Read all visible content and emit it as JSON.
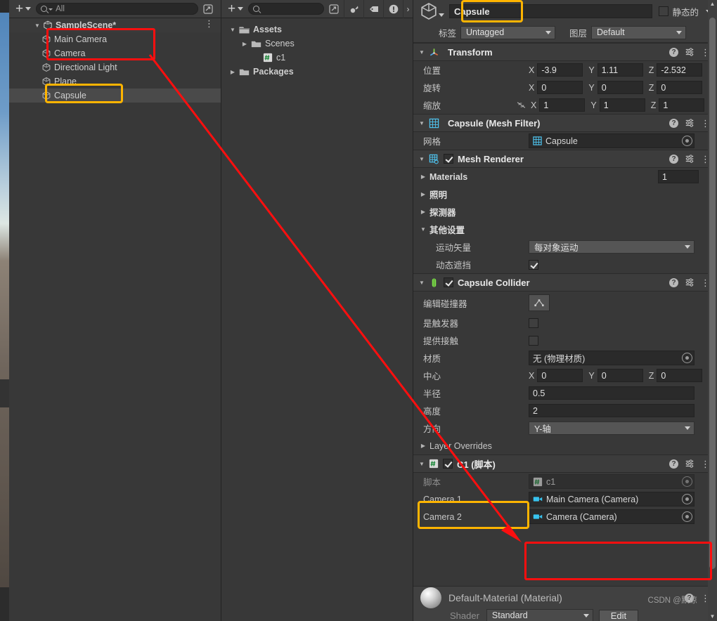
{
  "app": {
    "watermark": "CSDN @默凉"
  },
  "hierarchy": {
    "toolbar": {
      "add_label": "+",
      "search_placeholder": "All",
      "search_value": "",
      "expand_icon": "expand-icon"
    },
    "scene_name": "SampleScene*",
    "items": [
      {
        "label": "Main Camera",
        "icon": "gameobject-icon",
        "selected": false,
        "indent": 1
      },
      {
        "label": "Camera",
        "icon": "gameobject-icon",
        "selected": false,
        "indent": 1
      },
      {
        "label": "Directional Light",
        "icon": "gameobject-icon",
        "selected": false,
        "indent": 1
      },
      {
        "label": "Plane",
        "icon": "gameobject-icon",
        "selected": false,
        "indent": 1
      },
      {
        "label": "Capsule",
        "icon": "gameobject-icon",
        "selected": true,
        "indent": 1
      }
    ]
  },
  "project": {
    "toolbar": {
      "add_label": "+",
      "search_placeholder": "",
      "icons": [
        "save-search-icon",
        "label-icon",
        "warning-icon"
      ]
    },
    "items": [
      {
        "label": "Assets",
        "icon": "folder-open-icon",
        "expanded": true,
        "indent": 0,
        "bold": true
      },
      {
        "label": "Scenes",
        "icon": "folder-icon",
        "expanded": false,
        "indent": 1,
        "bold": false
      },
      {
        "label": "c1",
        "icon": "cs-script-icon",
        "expanded": null,
        "indent": 2,
        "bold": false
      },
      {
        "label": "Packages",
        "icon": "folder-icon",
        "expanded": false,
        "indent": 0,
        "bold": true
      }
    ]
  },
  "inspector": {
    "object": {
      "name": "Capsule",
      "static_label": "静态的",
      "static_checked": false,
      "tag_label": "标签",
      "tag_value": "Untagged",
      "layer_label": "图层",
      "layer_value": "Default"
    },
    "components": [
      {
        "id": "transform",
        "title": "Transform",
        "icon": "transform-axis-icon",
        "has_checkbox": false,
        "rows": [
          {
            "label": "位置",
            "type": "vector3",
            "x": "-3.9",
            "y": "1.11",
            "z": "-2.532"
          },
          {
            "label": "旋转",
            "type": "vector3",
            "x": "0",
            "y": "0",
            "z": "0"
          },
          {
            "label": "缩放",
            "type": "vector3",
            "x": "1",
            "y": "1",
            "z": "1",
            "lock_icon": "link-off-icon"
          }
        ]
      },
      {
        "id": "mesh-filter",
        "title": "Capsule (Mesh Filter)",
        "icon": "mesh-filter-icon",
        "has_checkbox": false,
        "rows": [
          {
            "label": "网格",
            "type": "object",
            "value": "Capsule",
            "value_icon": "mesh-icon"
          }
        ]
      },
      {
        "id": "mesh-renderer",
        "title": "Mesh Renderer",
        "icon": "mesh-renderer-icon",
        "has_checkbox": true,
        "checked": true,
        "rows": [
          {
            "label": "Materials",
            "type": "foldout",
            "expanded": false,
            "bold": true,
            "count": "1"
          },
          {
            "label": "照明",
            "type": "foldout",
            "expanded": false,
            "bold": true
          },
          {
            "label": "探测器",
            "type": "foldout",
            "expanded": false,
            "bold": true
          },
          {
            "label": "其他设置",
            "type": "foldout",
            "expanded": true,
            "bold": true
          },
          {
            "label": "运动矢量",
            "type": "dropdown",
            "value": "每对象运动",
            "indent": true
          },
          {
            "label": "动态遮挡",
            "type": "checkbox",
            "checked": true,
            "indent": true
          }
        ]
      },
      {
        "id": "capsule-collider",
        "title": "Capsule Collider",
        "icon": "capsule-collider-icon",
        "has_checkbox": true,
        "checked": true,
        "rows": [
          {
            "label": "编辑碰撞器",
            "type": "editbutton",
            "icon": "edit-collider-icon"
          },
          {
            "label": "是触发器",
            "type": "checkbox",
            "checked": false
          },
          {
            "label": "提供接触",
            "type": "checkbox",
            "checked": false
          },
          {
            "label": "材质",
            "type": "object",
            "value": "无 (物理材质)"
          },
          {
            "label": "中心",
            "type": "vector3",
            "x": "0",
            "y": "0",
            "z": "0"
          },
          {
            "label": "半径",
            "type": "text",
            "value": "0.5"
          },
          {
            "label": "高度",
            "type": "text",
            "value": "2"
          },
          {
            "label": "方向",
            "type": "dropdown",
            "value": "Y-轴"
          },
          {
            "label": "Layer Overrides",
            "type": "foldout",
            "expanded": false
          }
        ]
      },
      {
        "id": "c1-script",
        "title": "C1  (脚本)",
        "icon": "cs-script-icon",
        "has_checkbox": true,
        "checked": true,
        "rows": [
          {
            "label": "脚本",
            "type": "object",
            "value": "c1",
            "value_icon": "cs-script-icon",
            "disabled": true
          },
          {
            "label": "Camera 1",
            "type": "object",
            "value": "Main Camera (Camera)",
            "value_icon": "camera-icon"
          },
          {
            "label": "Camera 2",
            "type": "object",
            "value": "Camera (Camera)",
            "value_icon": "camera-icon"
          }
        ]
      }
    ],
    "material_preview": {
      "title": "Default-Material (Material)",
      "shader_label": "Shader",
      "shader_value": "Standard",
      "edit_label": "Edit"
    }
  },
  "annotations": {
    "highlight_color": "#ffb400",
    "arrow_color": "#fb0f0f",
    "boxes": [
      {
        "name": "hierarchy-cameras-box",
        "color": "#fb0f0f"
      },
      {
        "name": "hierarchy-capsule-box",
        "color": "#ffb400"
      },
      {
        "name": "inspector-name-box",
        "color": "#ffb400"
      },
      {
        "name": "c1-component-box",
        "color": "#ffb400"
      },
      {
        "name": "camera-fields-box",
        "color": "#fb0f0f"
      }
    ]
  }
}
